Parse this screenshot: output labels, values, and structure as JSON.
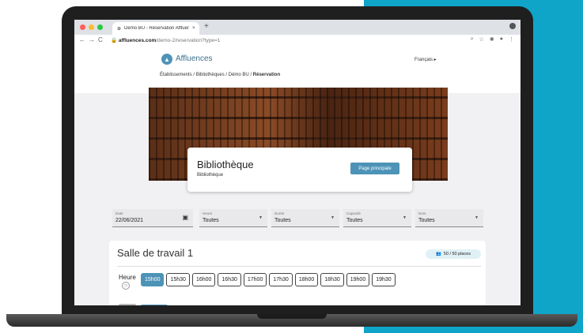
{
  "browser": {
    "tab_title": "Démo BU - Réservation Affluen",
    "tab_close": "×",
    "new_tab": "+",
    "url_host": "affluences.com",
    "url_path": "/demo-2/reservation?type=1"
  },
  "header": {
    "brand": "Affluences",
    "language": "Français ▸",
    "breadcrumb": {
      "items": [
        "Établissements",
        "Bibliothèques",
        "Démo BU"
      ],
      "separator": "/",
      "current": "Réservation"
    }
  },
  "library": {
    "title": "Bibliothèque",
    "subtitle": "Bibliothèque",
    "main_button": "Page principale"
  },
  "filters": {
    "date": {
      "label": "Date",
      "value": "22/06/2021"
    },
    "hour": {
      "label": "Heure",
      "value": "Toutes"
    },
    "duration": {
      "label": "Durée",
      "value": "Toutes"
    },
    "capacity": {
      "label": "Capacité",
      "value": "Toutes"
    },
    "name": {
      "label": "Nom",
      "value": "Toutes"
    }
  },
  "room": {
    "title": "Salle de travail 1",
    "places": "50 / 50 places",
    "hour_label": "Heure",
    "slots": [
      "15h00",
      "15h30",
      "16h00",
      "16h30",
      "17h00",
      "17h30",
      "18h00",
      "18h30",
      "19h00",
      "19h30"
    ],
    "selected_slot": "15h00"
  },
  "colors": {
    "accent": "#4d93b7",
    "background_teal": "#0ea5c9"
  }
}
